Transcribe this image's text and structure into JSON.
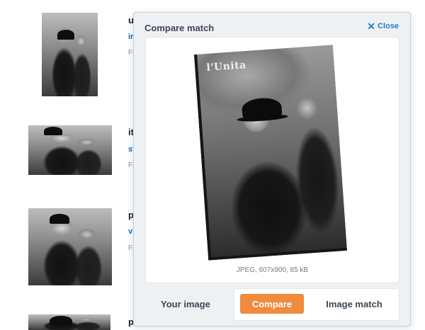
{
  "results": [
    {
      "title": "u",
      "link": "ir",
      "meta": "Fi"
    },
    {
      "title": "it",
      "link": "st",
      "meta": "Fi"
    },
    {
      "title": "p",
      "link": "vi",
      "meta": "Fi"
    },
    {
      "title": "p"
    }
  ],
  "modal": {
    "title": "Compare match",
    "close_label": "Close",
    "photo_caption": "l'Unita",
    "file_info": "JPEG, 607x900, 85 kB",
    "your_image_label": "Your image",
    "compare_label": "Compare",
    "image_match_label": "Image match"
  },
  "colors": {
    "accent": "#f08a3c",
    "link": "#2c7bc0",
    "modal_bg": "#eef1f4"
  }
}
